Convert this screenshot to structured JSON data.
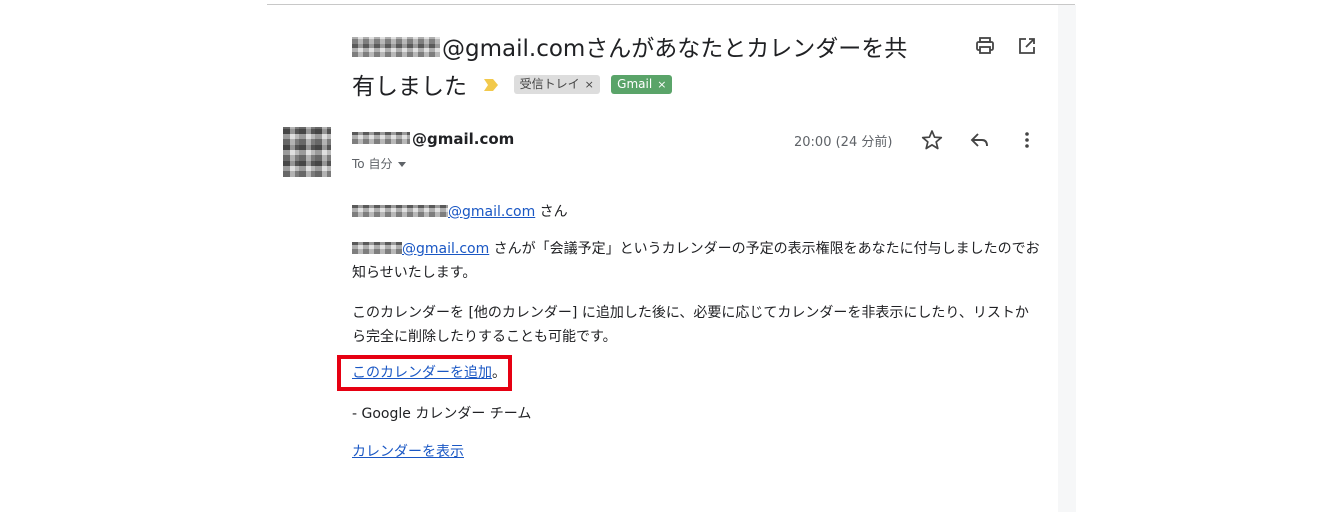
{
  "email": {
    "subject_line1": "@gmail.comさんがあなたとカレンダーを共",
    "subject_line2": "有しました",
    "labels": [
      {
        "text": "受信トレイ",
        "close": "×",
        "color": "#dddddd"
      },
      {
        "text": "Gmail",
        "close": "×",
        "color": "#5aa469"
      }
    ],
    "importance_color": "#f2c94c",
    "sender_domain": "@gmail.com",
    "recipient": "To 自分",
    "time": "20:00 (24 分前)",
    "body": {
      "greeting_link": "@gmail.com",
      "greeting_suffix": " さん",
      "para1_link": "@gmail.com",
      "para1_text": " さんが「会議予定」というカレンダーの予定の表示権限をあなたに付与しましたのでお知らせいたします。",
      "para2_text": "このカレンダーを [他のカレンダー] に追加した後に、必要に応じてカレンダーを非表示にしたり、リストから完全に削除したりすることも可能です。",
      "add_link": "このカレンダーを追加",
      "add_suffix": "。",
      "signoff": "- Google カレンダー チーム",
      "view_link": "カレンダーを表示"
    }
  },
  "icons": {
    "print": "print-icon",
    "open_new_window": "open-in-new-window-icon",
    "star": "star-icon",
    "reply": "reply-icon",
    "more": "more-vert-icon"
  },
  "colors": {
    "link": "#1a57c4",
    "highlight_box": "#e60012",
    "muted_text": "#5f6368"
  }
}
